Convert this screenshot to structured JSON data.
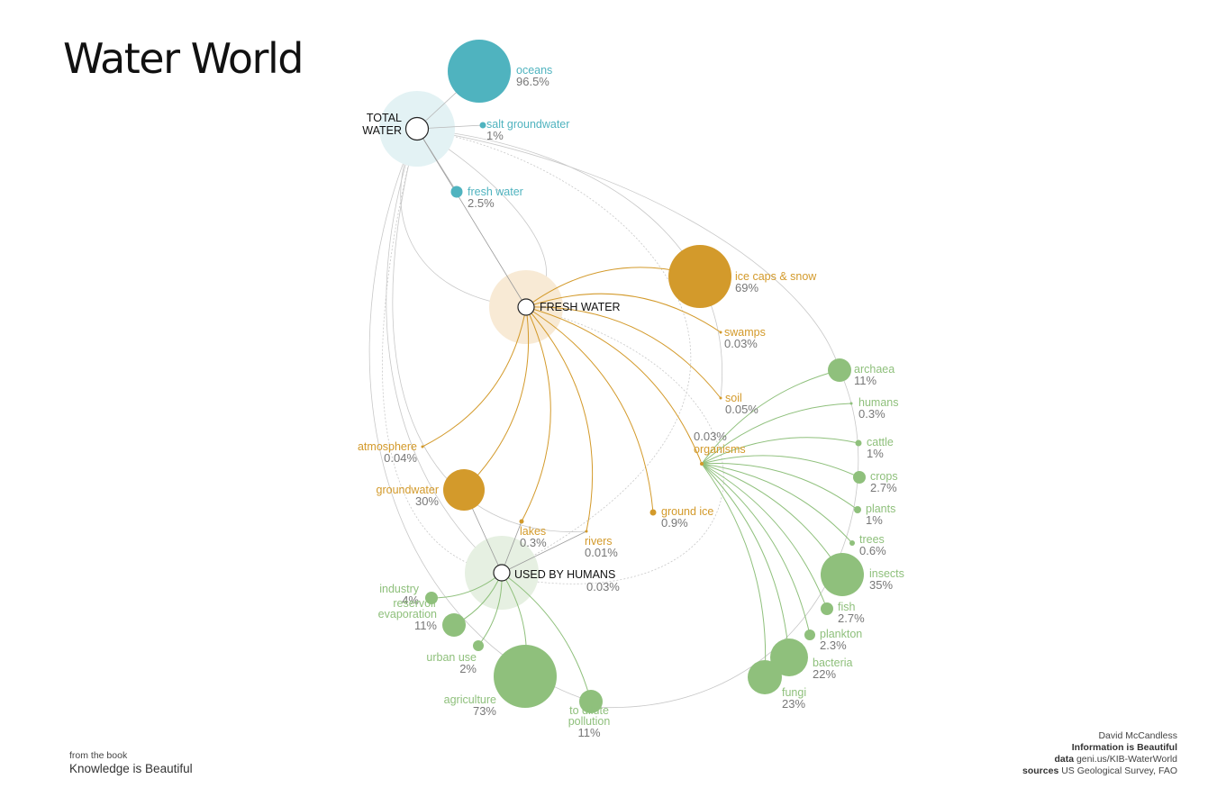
{
  "title": "Water World",
  "colors": {
    "blue": "#4fb3bf",
    "blue_halo": "#e3f2f4",
    "orange": "#d39a2b",
    "orange_halo": "#f8ead5",
    "green": "#8fc07c",
    "green_halo": "#e6f0e2",
    "gray_line": "#c8c8c8",
    "dark_text": "#111111",
    "value_text": "#777777"
  },
  "hubs": [
    {
      "id": "total-water",
      "label_lines": [
        "TOTAL",
        "WATER"
      ]
    },
    {
      "id": "fresh-water",
      "label_lines": [
        "FRESH WATER"
      ]
    },
    {
      "id": "used-by-humans",
      "label_lines": [
        "USED BY HUMANS"
      ],
      "value": "0.03%"
    }
  ],
  "nodes": [
    {
      "id": "oceans",
      "group": "total",
      "label_lines": [
        "oceans"
      ],
      "value": "96.5%"
    },
    {
      "id": "salt-groundwater",
      "group": "total",
      "label_lines": [
        "salt groundwater"
      ],
      "value": "1%"
    },
    {
      "id": "fresh-water-share",
      "group": "total",
      "label_lines": [
        "fresh water"
      ],
      "value": "2.5%"
    },
    {
      "id": "ice-caps-snow",
      "group": "fresh",
      "label_lines": [
        "ice caps & snow"
      ],
      "value": "69%"
    },
    {
      "id": "swamps",
      "group": "fresh",
      "label_lines": [
        "swamps"
      ],
      "value": "0.03%"
    },
    {
      "id": "soil",
      "group": "fresh",
      "label_lines": [
        "soil"
      ],
      "value": "0.05%"
    },
    {
      "id": "organisms",
      "group": "fresh",
      "label_lines": [
        "organisms"
      ],
      "value": "0.03%"
    },
    {
      "id": "atmosphere",
      "group": "fresh",
      "label_lines": [
        "atmosphere"
      ],
      "value": "0.04%"
    },
    {
      "id": "groundwater",
      "group": "fresh",
      "label_lines": [
        "groundwater"
      ],
      "value": "30%"
    },
    {
      "id": "lakes",
      "group": "fresh",
      "label_lines": [
        "lakes"
      ],
      "value": "0.3%"
    },
    {
      "id": "rivers",
      "group": "fresh",
      "label_lines": [
        "rivers"
      ],
      "value": "0.01%"
    },
    {
      "id": "ground-ice",
      "group": "fresh",
      "label_lines": [
        "ground ice"
      ],
      "value": "0.9%"
    },
    {
      "id": "industry",
      "group": "human",
      "label_lines": [
        "industry"
      ],
      "value": "4%"
    },
    {
      "id": "reservoir-evaporation",
      "group": "human",
      "label_lines": [
        "reservoir",
        "evaporation"
      ],
      "value": "11%"
    },
    {
      "id": "urban-use",
      "group": "human",
      "label_lines": [
        "urban use"
      ],
      "value": "2%"
    },
    {
      "id": "agriculture",
      "group": "human",
      "label_lines": [
        "agriculture"
      ],
      "value": "73%"
    },
    {
      "id": "to-dilute-pollution",
      "group": "human",
      "label_lines": [
        "to dilute",
        "pollution"
      ],
      "value": "11%"
    },
    {
      "id": "archaea",
      "group": "organism",
      "label_lines": [
        "archaea"
      ],
      "value": "11%"
    },
    {
      "id": "humans",
      "group": "organism",
      "label_lines": [
        "humans"
      ],
      "value": "0.3%"
    },
    {
      "id": "cattle",
      "group": "organism",
      "label_lines": [
        "cattle"
      ],
      "value": "1%"
    },
    {
      "id": "crops",
      "group": "organism",
      "label_lines": [
        "crops"
      ],
      "value": "2.7%"
    },
    {
      "id": "plants",
      "group": "organism",
      "label_lines": [
        "plants"
      ],
      "value": "1%"
    },
    {
      "id": "trees",
      "group": "organism",
      "label_lines": [
        "trees"
      ],
      "value": "0.6%"
    },
    {
      "id": "insects",
      "group": "organism",
      "label_lines": [
        "insects"
      ],
      "value": "35%"
    },
    {
      "id": "fish",
      "group": "organism",
      "label_lines": [
        "fish"
      ],
      "value": "2.7%"
    },
    {
      "id": "plankton",
      "group": "organism",
      "label_lines": [
        "plankton"
      ],
      "value": "2.3%"
    },
    {
      "id": "bacteria",
      "group": "organism",
      "label_lines": [
        "bacteria"
      ],
      "value": "22%"
    },
    {
      "id": "fungi",
      "group": "organism",
      "label_lines": [
        "fungi"
      ],
      "value": "23%"
    }
  ],
  "footer": {
    "left_small": "from the book",
    "left_title": "Knowledge is Beautiful",
    "author": "David McCandless",
    "book": "Information is Beautiful",
    "data_label": "data",
    "data_value": "geni.us/KIB-WaterWorld",
    "sources_label": "sources",
    "sources_value": "US Geological Survey, FAO"
  }
}
